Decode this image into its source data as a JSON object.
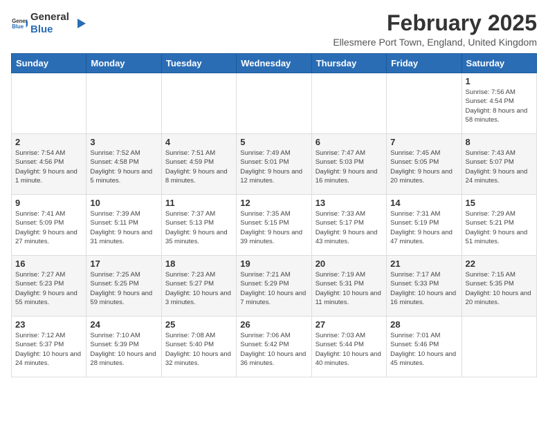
{
  "logo": {
    "general": "General",
    "blue": "Blue"
  },
  "title": "February 2025",
  "subtitle": "Ellesmere Port Town, England, United Kingdom",
  "days_of_week": [
    "Sunday",
    "Monday",
    "Tuesday",
    "Wednesday",
    "Thursday",
    "Friday",
    "Saturday"
  ],
  "weeks": [
    [
      {
        "day": "",
        "info": ""
      },
      {
        "day": "",
        "info": ""
      },
      {
        "day": "",
        "info": ""
      },
      {
        "day": "",
        "info": ""
      },
      {
        "day": "",
        "info": ""
      },
      {
        "day": "",
        "info": ""
      },
      {
        "day": "1",
        "info": "Sunrise: 7:56 AM\nSunset: 4:54 PM\nDaylight: 8 hours and 58 minutes."
      }
    ],
    [
      {
        "day": "2",
        "info": "Sunrise: 7:54 AM\nSunset: 4:56 PM\nDaylight: 9 hours and 1 minute."
      },
      {
        "day": "3",
        "info": "Sunrise: 7:52 AM\nSunset: 4:58 PM\nDaylight: 9 hours and 5 minutes."
      },
      {
        "day": "4",
        "info": "Sunrise: 7:51 AM\nSunset: 4:59 PM\nDaylight: 9 hours and 8 minutes."
      },
      {
        "day": "5",
        "info": "Sunrise: 7:49 AM\nSunset: 5:01 PM\nDaylight: 9 hours and 12 minutes."
      },
      {
        "day": "6",
        "info": "Sunrise: 7:47 AM\nSunset: 5:03 PM\nDaylight: 9 hours and 16 minutes."
      },
      {
        "day": "7",
        "info": "Sunrise: 7:45 AM\nSunset: 5:05 PM\nDaylight: 9 hours and 20 minutes."
      },
      {
        "day": "8",
        "info": "Sunrise: 7:43 AM\nSunset: 5:07 PM\nDaylight: 9 hours and 24 minutes."
      }
    ],
    [
      {
        "day": "9",
        "info": "Sunrise: 7:41 AM\nSunset: 5:09 PM\nDaylight: 9 hours and 27 minutes."
      },
      {
        "day": "10",
        "info": "Sunrise: 7:39 AM\nSunset: 5:11 PM\nDaylight: 9 hours and 31 minutes."
      },
      {
        "day": "11",
        "info": "Sunrise: 7:37 AM\nSunset: 5:13 PM\nDaylight: 9 hours and 35 minutes."
      },
      {
        "day": "12",
        "info": "Sunrise: 7:35 AM\nSunset: 5:15 PM\nDaylight: 9 hours and 39 minutes."
      },
      {
        "day": "13",
        "info": "Sunrise: 7:33 AM\nSunset: 5:17 PM\nDaylight: 9 hours and 43 minutes."
      },
      {
        "day": "14",
        "info": "Sunrise: 7:31 AM\nSunset: 5:19 PM\nDaylight: 9 hours and 47 minutes."
      },
      {
        "day": "15",
        "info": "Sunrise: 7:29 AM\nSunset: 5:21 PM\nDaylight: 9 hours and 51 minutes."
      }
    ],
    [
      {
        "day": "16",
        "info": "Sunrise: 7:27 AM\nSunset: 5:23 PM\nDaylight: 9 hours and 55 minutes."
      },
      {
        "day": "17",
        "info": "Sunrise: 7:25 AM\nSunset: 5:25 PM\nDaylight: 9 hours and 59 minutes."
      },
      {
        "day": "18",
        "info": "Sunrise: 7:23 AM\nSunset: 5:27 PM\nDaylight: 10 hours and 3 minutes."
      },
      {
        "day": "19",
        "info": "Sunrise: 7:21 AM\nSunset: 5:29 PM\nDaylight: 10 hours and 7 minutes."
      },
      {
        "day": "20",
        "info": "Sunrise: 7:19 AM\nSunset: 5:31 PM\nDaylight: 10 hours and 11 minutes."
      },
      {
        "day": "21",
        "info": "Sunrise: 7:17 AM\nSunset: 5:33 PM\nDaylight: 10 hours and 16 minutes."
      },
      {
        "day": "22",
        "info": "Sunrise: 7:15 AM\nSunset: 5:35 PM\nDaylight: 10 hours and 20 minutes."
      }
    ],
    [
      {
        "day": "23",
        "info": "Sunrise: 7:12 AM\nSunset: 5:37 PM\nDaylight: 10 hours and 24 minutes."
      },
      {
        "day": "24",
        "info": "Sunrise: 7:10 AM\nSunset: 5:39 PM\nDaylight: 10 hours and 28 minutes."
      },
      {
        "day": "25",
        "info": "Sunrise: 7:08 AM\nSunset: 5:40 PM\nDaylight: 10 hours and 32 minutes."
      },
      {
        "day": "26",
        "info": "Sunrise: 7:06 AM\nSunset: 5:42 PM\nDaylight: 10 hours and 36 minutes."
      },
      {
        "day": "27",
        "info": "Sunrise: 7:03 AM\nSunset: 5:44 PM\nDaylight: 10 hours and 40 minutes."
      },
      {
        "day": "28",
        "info": "Sunrise: 7:01 AM\nSunset: 5:46 PM\nDaylight: 10 hours and 45 minutes."
      },
      {
        "day": "",
        "info": ""
      }
    ]
  ]
}
